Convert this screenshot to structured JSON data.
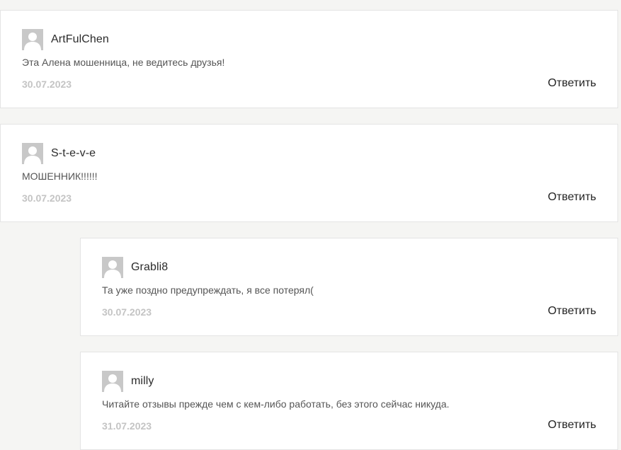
{
  "comments": [
    {
      "author": "ArtFulChen",
      "text": "Эта Алена мошенница, не ведитесь друзья!",
      "date": "30.07.2023",
      "reply_label": "Ответить"
    },
    {
      "author": "S-t-e-v-e",
      "text": "МОШЕННИК!!!!!!",
      "date": "30.07.2023",
      "reply_label": "Ответить"
    },
    {
      "author": "Grabli8",
      "text": "Та уже поздно предупреждать, я все потерял(",
      "date": "30.07.2023",
      "reply_label": "Ответить"
    },
    {
      "author": "milly",
      "text": "Читайте отзывы прежде чем с кем-либо работать, без этого сейчас никуда.",
      "date": "31.07.2023",
      "reply_label": "Ответить"
    }
  ],
  "colors": {
    "page_background": "#f5f5f3",
    "card_background": "#ffffff",
    "avatar_placeholder": "#c8c8c8",
    "date_text": "#c4c4c4"
  },
  "icons": {
    "avatar": "user-placeholder-icon"
  }
}
